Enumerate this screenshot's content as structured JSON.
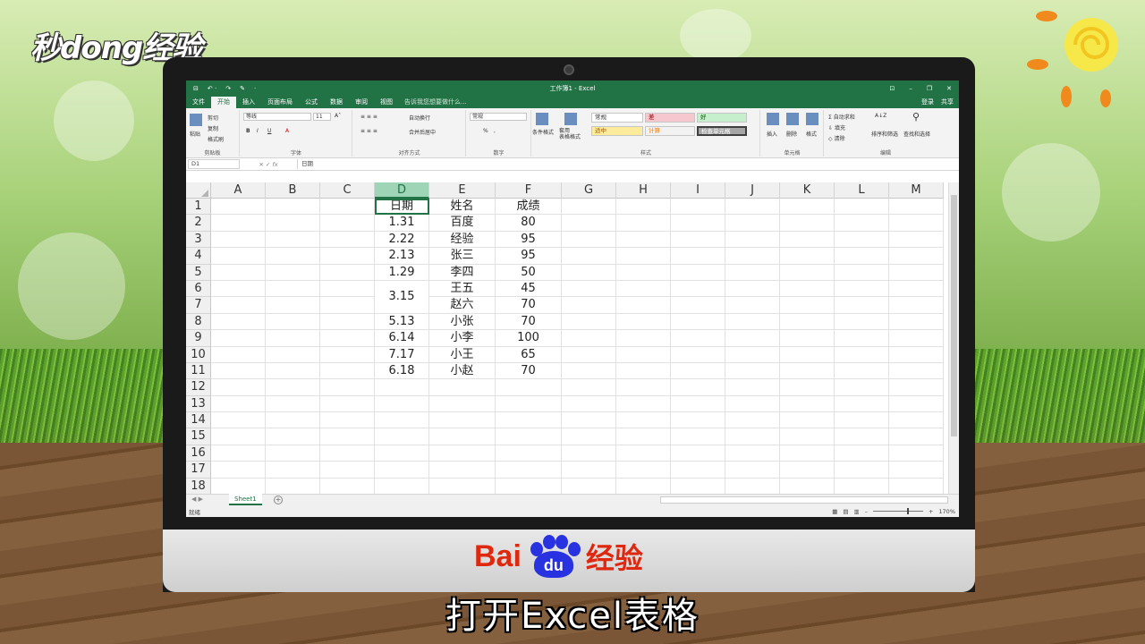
{
  "watermark": {
    "brand": "秒dong经验"
  },
  "excel": {
    "title": "工作簿1 - Excel",
    "quick_access": [
      "⊟",
      "↶ ·",
      "↷",
      "✎",
      "·"
    ],
    "window_controls": [
      "⊡",
      "–",
      "❐",
      "✕"
    ],
    "tabs": [
      "文件",
      "开始",
      "插入",
      "页面布局",
      "公式",
      "数据",
      "审阅",
      "视图"
    ],
    "active_tab": "开始",
    "tell_me": "告诉我您想要做什么...",
    "login": "登录",
    "share": "共享",
    "ribbon": {
      "clipboard": {
        "label": "剪贴板",
        "paste": "粘贴",
        "cut": "剪切",
        "copy": "复制",
        "format_painter": "格式刷"
      },
      "font": {
        "label": "字体",
        "font_name": "等线",
        "font_size": "11",
        "bold": "B",
        "italic": "I",
        "underline": "U"
      },
      "alignment": {
        "label": "对齐方式",
        "wrap": "自动换行",
        "merge": "合并后居中"
      },
      "number": {
        "label": "数字",
        "format": "常规",
        "percent": "%",
        "comma": ","
      },
      "styles": {
        "label": "样式",
        "conditional": "条件格式",
        "table": "套用\n表格格式",
        "normal": "常规",
        "bad": "差",
        "good": "好",
        "neutral": "适中",
        "calc": "计算",
        "check": "检查单元格"
      },
      "cells": {
        "label": "单元格",
        "insert": "插入",
        "delete": "删除",
        "format": "格式"
      },
      "editing": {
        "label": "编辑",
        "autosum": "自动求和",
        "fill": "填充",
        "clear": "清除",
        "sort": "排序和筛选",
        "find": "查找和选择"
      }
    },
    "formula_bar": {
      "name_box": "D1",
      "fx": "fx",
      "content": "日期"
    },
    "columns": [
      "A",
      "B",
      "C",
      "D",
      "E",
      "F",
      "G",
      "H",
      "I",
      "J",
      "K",
      "L",
      "M"
    ],
    "row_numbers": [
      "1",
      "2",
      "3",
      "4",
      "5",
      "6",
      "7",
      "8",
      "9",
      "10",
      "11",
      "12",
      "13",
      "14",
      "15",
      "16",
      "17",
      "18"
    ],
    "table": {
      "headers": [
        "日期",
        "姓名",
        "成绩"
      ],
      "rows": [
        [
          "1.31",
          "百度",
          "80"
        ],
        [
          "2.22",
          "经验",
          "95"
        ],
        [
          "2.13",
          "张三",
          "95"
        ],
        [
          "1.29",
          "李四",
          "50"
        ],
        [
          "3.15",
          "王五",
          "45"
        ],
        [
          "",
          "赵六",
          "70"
        ],
        [
          "5.13",
          "小张",
          "70"
        ],
        [
          "6.14",
          "小李",
          "100"
        ],
        [
          "7.17",
          "小王",
          "65"
        ],
        [
          "6.18",
          "小赵",
          "70"
        ]
      ]
    },
    "sheet_tab": "Sheet1",
    "add_sheet": "+",
    "status": "就绪",
    "zoom": "170%"
  },
  "baidu": {
    "left": "Bai",
    "paw": "du",
    "suffix": "经验"
  },
  "caption": "打开Excel表格"
}
